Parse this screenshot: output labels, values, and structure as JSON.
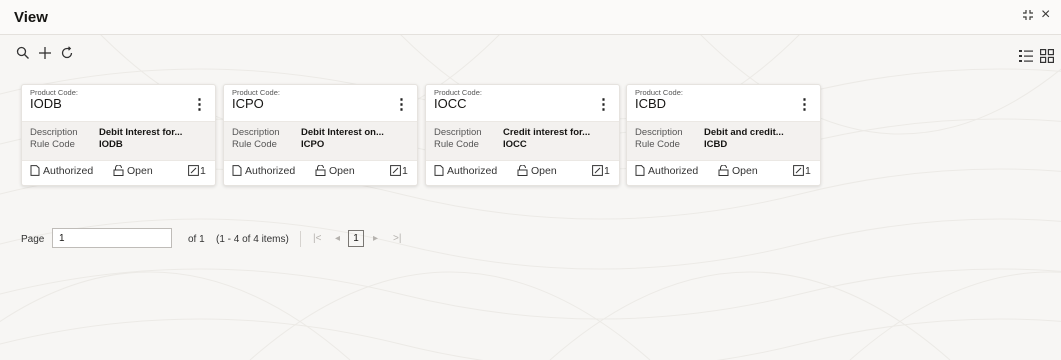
{
  "header": {
    "title": "View"
  },
  "window_controls": {
    "expand_icon": "expand-icon",
    "close_glyph": "×"
  },
  "toolbar": {
    "icons": [
      "search-icon",
      "add-icon",
      "refresh-icon"
    ]
  },
  "view_toggle": {
    "icons": [
      "list-view-icon",
      "grid-view-icon"
    ]
  },
  "cards": [
    {
      "code_label": "Product Code:",
      "code": "IODB",
      "desc_label": "Description",
      "description": "Debit Interest for...",
      "rule_label": "Rule Code",
      "rule_code": "IODB",
      "status": "Authorized",
      "lock_status": "Open",
      "count": "1"
    },
    {
      "code_label": "Product Code:",
      "code": "ICPO",
      "desc_label": "Description",
      "description": "Debit Interest on...",
      "rule_label": "Rule Code",
      "rule_code": "ICPO",
      "status": "Authorized",
      "lock_status": "Open",
      "count": "1"
    },
    {
      "code_label": "Product Code:",
      "code": "IOCC",
      "desc_label": "Description",
      "description": "Credit interest for...",
      "rule_label": "Rule Code",
      "rule_code": "IOCC",
      "status": "Authorized",
      "lock_status": "Open",
      "count": "1"
    },
    {
      "code_label": "Product Code:",
      "code": "ICBD",
      "desc_label": "Description",
      "description": "Debit and credit...",
      "rule_label": "Rule Code",
      "rule_code": "ICBD",
      "status": "Authorized",
      "lock_status": "Open",
      "count": "1"
    }
  ],
  "pagination": {
    "page_label": "Page",
    "page_value": "1",
    "of_text": "of 1",
    "items_text": "(1 - 4 of 4 items)",
    "current_page": "1",
    "nav_glyphs": {
      "first": "|<",
      "prev": "◂",
      "next": "▸",
      "last": ">|"
    }
  }
}
